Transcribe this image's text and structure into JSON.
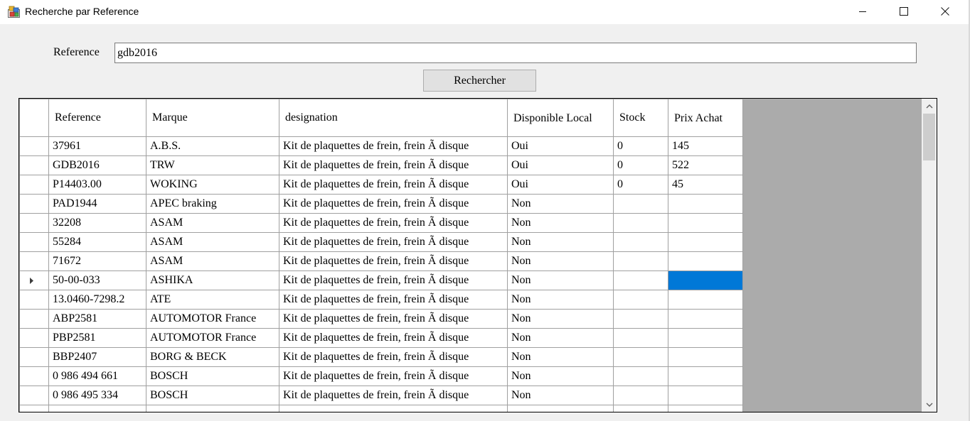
{
  "window": {
    "title": "Recherche par Reference"
  },
  "search": {
    "label": "Reference",
    "value": "gdb2016",
    "button_label": "Rechercher"
  },
  "grid": {
    "columns": [
      {
        "label": "Reference"
      },
      {
        "label": "Marque"
      },
      {
        "label": "designation"
      },
      {
        "label": "Disponible Local"
      },
      {
        "label": "Stock"
      },
      {
        "label": "Prix Achat"
      }
    ],
    "current_row_index": 7,
    "rows": [
      [
        "37961",
        "A.B.S.",
        "Kit de plaquettes de frein, frein Ã  disque",
        "Oui",
        "0",
        "145"
      ],
      [
        "GDB2016",
        "TRW",
        "Kit de plaquettes de frein, frein Ã  disque",
        "Oui",
        "0",
        "522"
      ],
      [
        "P14403.00",
        "WOKING",
        "Kit de plaquettes de frein, frein Ã  disque",
        "Oui",
        "0",
        "45"
      ],
      [
        "PAD1944",
        "APEC braking",
        "Kit de plaquettes de frein, frein Ã  disque",
        "Non",
        "",
        ""
      ],
      [
        "32208",
        "ASAM",
        "Kit de plaquettes de frein, frein Ã  disque",
        "Non",
        "",
        ""
      ],
      [
        "55284",
        "ASAM",
        "Kit de plaquettes de frein, frein Ã  disque",
        "Non",
        "",
        ""
      ],
      [
        "71672",
        "ASAM",
        "Kit de plaquettes de frein, frein Ã  disque",
        "Non",
        "",
        ""
      ],
      [
        "50-00-033",
        "ASHIKA",
        "Kit de plaquettes de frein, frein Ã  disque",
        "Non",
        "",
        ""
      ],
      [
        "13.0460-7298.2",
        "ATE",
        "Kit de plaquettes de frein, frein Ã  disque",
        "Non",
        "",
        ""
      ],
      [
        "ABP2581",
        "AUTOMOTOR France",
        "Kit de plaquettes de frein, frein Ã  disque",
        "Non",
        "",
        ""
      ],
      [
        "PBP2581",
        "AUTOMOTOR France",
        "Kit de plaquettes de frein, frein Ã  disque",
        "Non",
        "",
        ""
      ],
      [
        "BBP2407",
        "BORG & BECK",
        "Kit de plaquettes de frein, frein Ã  disque",
        "Non",
        "",
        ""
      ],
      [
        "0 986 494 661",
        "BOSCH",
        "Kit de plaquettes de frein, frein Ã  disque",
        "Non",
        "",
        ""
      ],
      [
        "0 986 495 334",
        "BOSCH",
        "Kit de plaquettes de frein, frein Ã  disque",
        "Non",
        "",
        ""
      ],
      [
        "",
        "",
        "",
        "",
        "",
        ""
      ]
    ]
  },
  "icons": {
    "app": "app-icon",
    "minimize": "minimize-icon",
    "maximize": "maximize-icon",
    "close": "close-icon",
    "row_indicator": "row-indicator-icon",
    "scroll_up": "scroll-up-icon",
    "scroll_down": "scroll-down-icon"
  },
  "colors": {
    "selection": "#0078d7",
    "grid_background": "#ababab"
  }
}
